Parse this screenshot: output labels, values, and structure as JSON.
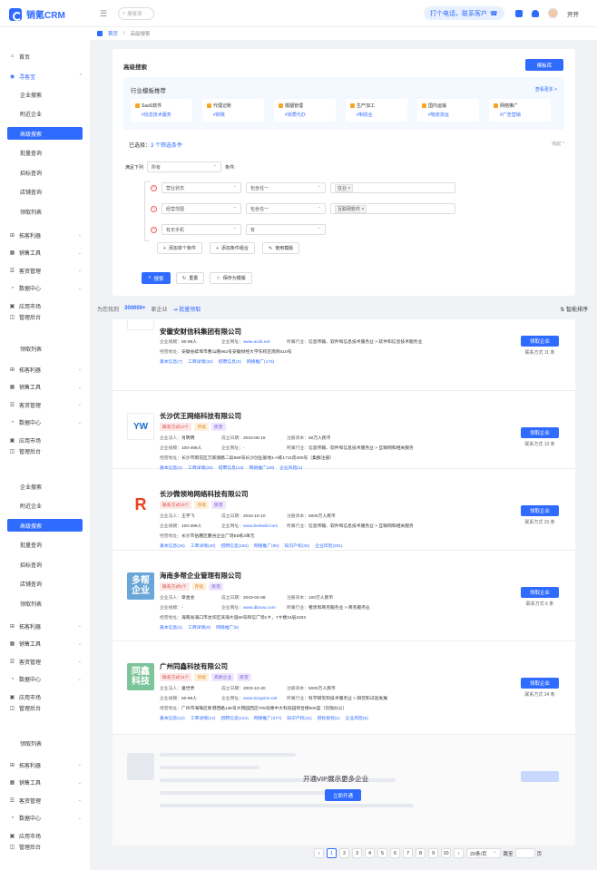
{
  "app": {
    "name": "销氪CRM",
    "search_placeholder": "搜客资",
    "phone_banner": "打个电话，联系客户",
    "user": "开开"
  },
  "breadcrumb": {
    "home": "首页",
    "current": "高级搜索"
  },
  "sidebar": {
    "top": [
      {
        "label": "首页",
        "icon": "home-icon"
      },
      {
        "label": "寻客宝",
        "icon": "compass-icon",
        "chev": "^"
      }
    ],
    "group": [
      {
        "label": "企业搜索"
      },
      {
        "label": "附近企业"
      },
      {
        "label": "高级搜索"
      },
      {
        "label": "批量查询"
      },
      {
        "label": "招标查询"
      },
      {
        "label": "店铺查询"
      },
      {
        "label": "领取列表"
      }
    ],
    "modules": [
      {
        "label": "拓客利器"
      },
      {
        "label": "销售工具"
      },
      {
        "label": "客资管理"
      },
      {
        "label": "数据中心"
      },
      {
        "label": "应用市场"
      },
      {
        "label": "管理后台"
      }
    ]
  },
  "search_panel": {
    "title": "高级搜索",
    "template_button": "模板库",
    "rec_title": "行业模板推荐",
    "rec_more": "查看更多 >",
    "rec_cards": [
      {
        "title": "SaaS软件",
        "sub": "#信息技术服务"
      },
      {
        "title": "代理记账",
        "sub": "#财税"
      },
      {
        "title": "婚姻管理",
        "sub": "#资质代办"
      },
      {
        "title": "生产加工",
        "sub": "#制造业"
      },
      {
        "title": "国内运输",
        "sub": "#物流货运"
      },
      {
        "title": "网络推广",
        "sub": "#广告营销"
      }
    ],
    "selected_label": "已选择：",
    "selected_count": "3 个筛选条件",
    "collapse": "收起 ^",
    "satisfy_label": "满足下列",
    "satisfy_value": "所有",
    "condition_label": "条件:",
    "rules": [
      {
        "field": "营业状态",
        "op": "包含任一",
        "tag": "在业"
      },
      {
        "field": "经营范围",
        "op": "包含任一",
        "tag": "互联网软件"
      },
      {
        "field": "有无手机",
        "op": "有",
        "tag": ""
      }
    ],
    "add_single": "添加单个条件",
    "add_group": "添加条件组合",
    "use_template": "使用模版",
    "btn_search": "搜索",
    "btn_reset": "重置",
    "btn_save": "保存为模版"
  },
  "results": {
    "found_prefix": "为您找到",
    "found_count": "300000+",
    "found_suffix": "家企业",
    "bulk": "批量领取",
    "sort": "智能排序"
  },
  "companies": [
    {
      "name": "安徽安财信科集团有限公司",
      "tags": [],
      "logo": "",
      "logo_color": "#ffffff",
      "scale_label": "企业规模：",
      "scale": "50-99人",
      "site_label": "企业网址：",
      "site": "www.acxk.net",
      "industry_label": "所属行业：",
      "industry": "信息传输、软件和信息技术服务业 > 软件和信息技术服务业",
      "addr_label": "经营地址：",
      "addr": "安徽省蚌埠市曹山路962号安徽财经大学东校区南侧416号",
      "links": [
        "基本信息(7)",
        "工商详情(32)",
        "招聘信息(0)",
        "网络推广(175)"
      ],
      "claim": "领取企业",
      "contact": "联系方式 11 条"
    },
    {
      "name": "长沙优王网络科技有限公司",
      "tags": [
        {
          "t": "联系方式10个",
          "c": "r"
        },
        {
          "t": "存续",
          "c": "o"
        },
        {
          "t": "民营",
          "c": "p"
        }
      ],
      "logo": "YW",
      "logo_color": "#1a6fd0",
      "legal_label": "企业法人：",
      "legal": "肖明明",
      "date_label": "成立日期：",
      "date": "2016-08-15",
      "cap_label": "注册资本：",
      "cap": "50万人民币",
      "scale_label": "企业规模：",
      "scale": "100-499人",
      "site_label": "企业网址：",
      "site": "-",
      "industry_label": "所属行业：",
      "industry": "信息传输、软件和信息技术服务业 > 互联网和相关服务",
      "addr_label": "经营地址：",
      "addr": "长沙市雨花区万家丽路二段668号长沙创业基地1-A栋1711房260号（集群注册）",
      "links": [
        "基本信息(4)",
        "工商详情(26)",
        "招聘信息(13)",
        "网络推广(49)",
        "企业风险(1)"
      ],
      "claim": "领取企业",
      "contact": "联系方式 10 条"
    },
    {
      "name": "长沙微领地网络科技有限公司",
      "tags": [
        {
          "t": "联系方式20个",
          "c": "r"
        },
        {
          "t": "存续",
          "c": "o"
        },
        {
          "t": "民营",
          "c": "p"
        }
      ],
      "logo": "R",
      "logo_color": "#e8421d",
      "legal_label": "企业法人：",
      "legal": "王宇飞",
      "date_label": "成立日期：",
      "date": "2015-10-10",
      "cap_label": "注册资本：",
      "cap": "5000万人民币",
      "scale_label": "企业规模：",
      "scale": "100-499人",
      "site_label": "企业网址：",
      "site": "www.bestwld.com",
      "industry_label": "所属行业：",
      "industry": "信息传输、软件和信息技术服务业 > 互联网和相关服务",
      "addr_label": "经营地址：",
      "addr": "长沙市岳麓区麓谷企业广场E5栋2单元",
      "links": [
        "基本信息(26)",
        "工商详情(40)",
        "招聘信息(192)",
        "网络推广(65)",
        "知识产权(32)",
        "企业风险(301)"
      ],
      "claim": "领取企业",
      "contact": "联系方式 20 条"
    },
    {
      "name": "海南多帮企业管理有限公司",
      "tags": [
        {
          "t": "联系方式6个",
          "c": "r"
        },
        {
          "t": "存续",
          "c": "o"
        },
        {
          "t": "民营",
          "c": "p"
        }
      ],
      "logo": "多帮\n企业",
      "logo_color": "#6aa6d8",
      "legal_label": "企业法人：",
      "legal": "章金会",
      "date_label": "成立日期：",
      "date": "2019-04-08",
      "cap_label": "注册资本：",
      "cap": "100万人民币",
      "scale_label": "企业规模：",
      "scale": "-",
      "site_label": "企业网址：",
      "site": "www.dbcwu.com",
      "industry_label": "所属行业：",
      "industry": "租赁和商务服务业 > 商务服务业",
      "addr_label": "经营地址：",
      "addr": "海南省海口市龙华区滨海大道60号和信广场1＃，7＃楼24层2403",
      "links": [
        "基本信息(2)",
        "工商详情(9)",
        "网络推广(5)"
      ],
      "claim": "领取企业",
      "contact": "联系方式 6 条"
    },
    {
      "name": "广州同鑫科技有限公司",
      "tags": [
        {
          "t": "联系方式34个",
          "c": "r"
        },
        {
          "t": "存续",
          "c": "o"
        },
        {
          "t": "高新企业",
          "c": "p"
        },
        {
          "t": "民营",
          "c": "p"
        }
      ],
      "logo": "同鑫\n科技",
      "logo_color": "#7cc49a",
      "legal_label": "企业法人：",
      "legal": "童世贵",
      "date_label": "成立日期：",
      "date": "2003-10-20",
      "cap_label": "注册资本：",
      "cap": "5000万人民币",
      "scale_label": "企业规模：",
      "scale": "50-99人",
      "site_label": "企业网址：",
      "site": "www.tongxine.net",
      "industry_label": "所属行业：",
      "industry": "科学研究和技术服务业 > 研究和试验发展",
      "addr_label": "经营地址：",
      "addr": "广州市海珠区新港西路135号大院园西区705号楼中大科技园综合楼606室（仅限办公）",
      "links": [
        "基本信息(12)",
        "工商详情(14)",
        "招聘信息(124)",
        "网络推广(277)",
        "知识产权(11)",
        "招标投标(1)",
        "企业风险(6)"
      ],
      "claim": "领取企业",
      "contact": "联系方式 34 条"
    }
  ],
  "vip": {
    "title": "开通VIP展示更多企业",
    "button": "立即开通"
  },
  "pagination": {
    "pages": [
      "1",
      "2",
      "3",
      "4",
      "5",
      "6",
      "7",
      "8",
      "9",
      "10"
    ],
    "page_size": "20条/页",
    "jump_label": "跳至",
    "page_suffix": "页"
  }
}
